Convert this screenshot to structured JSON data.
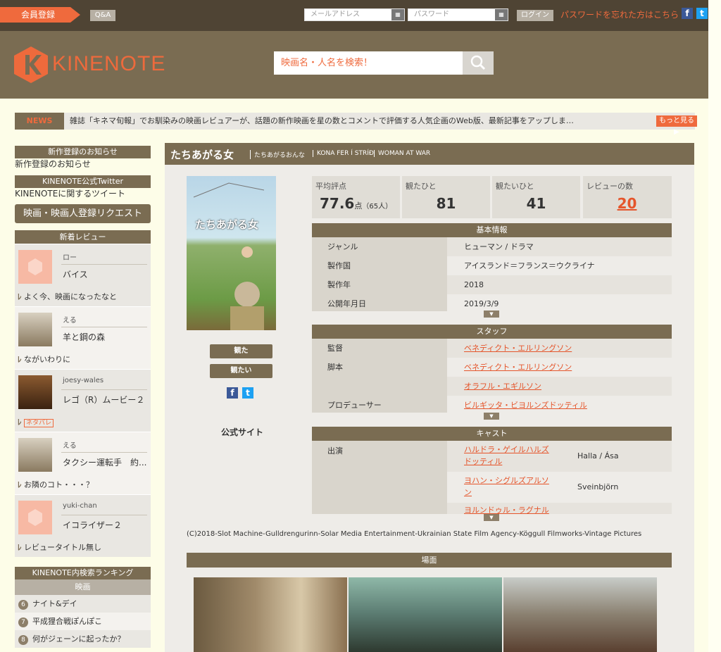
{
  "topbar": {
    "signup": "会員登録",
    "qa": "Q&A",
    "email_placeholder": "メールアドレス",
    "password_placeholder": "パスワード",
    "login": "ログイン",
    "forgot": "パスワードを忘れた方はこちら",
    "facebook": "f",
    "twitter": "t"
  },
  "header": {
    "brand": "KINENOTE",
    "search_placeholder": "映画名・人名を検索！"
  },
  "news": {
    "label": "NEWS",
    "text": "雑誌「キネマ旬報」でお馴染みの映画レビュアーが、話題の新作映画を星の数とコメントで評価する人気企画のWeb版、最新記事をアップしま…",
    "more": "もっと見る"
  },
  "sidebar": {
    "new_works_header": "新作登録のお知らせ",
    "new_works_link": "新作登録のお知らせ",
    "twitter_header": "KINENOTE公式Twitter",
    "twitter_link": "KINENOTEに関するツイート",
    "request_button": "映画・映画人登録リクエスト",
    "reviews_header": "新着レビュー",
    "reviews": [
      {
        "user": "ロー",
        "movie": "バイス",
        "title": "よく今、映画になったなと",
        "spoiler": ""
      },
      {
        "user": "える",
        "movie": "羊と鋼の森",
        "title": "ながいわりに",
        "spoiler": ""
      },
      {
        "user": "joesy-wales",
        "movie": "レゴ（R）ムービー２",
        "title": "",
        "spoiler": "ネタバレ"
      },
      {
        "user": "える",
        "movie": "タクシー運転手　約...",
        "title": "お隣のコト・・・？",
        "spoiler": ""
      },
      {
        "user": "yuki-chan",
        "movie": "イコライザー２",
        "title": "レビュータイトル無し",
        "spoiler": ""
      }
    ],
    "ranking_header": "KINENOTE内検索ランキング",
    "ranking_tab": "映画",
    "ranking": [
      {
        "num": "6",
        "title": "ナイト&デイ"
      },
      {
        "num": "7",
        "title": "平成狸合戦ぽんぽこ"
      },
      {
        "num": "8",
        "title": "何がジェーンに起ったか？"
      }
    ]
  },
  "movie": {
    "title": "たちあがる女",
    "alt_titles": [
      "たちあがるおんな",
      "KONA FER Í STRÍÐ",
      "WOMAN AT WAR"
    ],
    "poster_title": "たちあがる女",
    "watched_button": "観た",
    "want_button": "観たい",
    "facebook": "f",
    "twitter": "t",
    "official_site": "公式サイト",
    "stats": {
      "avg_label": "平均評点",
      "avg_value": "77.6",
      "avg_unit": "点",
      "avg_count": "（65人）",
      "watched_label": "観たひと",
      "watched_value": "81",
      "want_label": "観たいひと",
      "want_value": "41",
      "reviews_label": "レビューの数",
      "reviews_value": "20"
    },
    "basic_header": "基本情報",
    "basic": [
      {
        "k": "ジャンル",
        "v": "ヒューマン / ドラマ"
      },
      {
        "k": "製作国",
        "v": "アイスランド＝フランス＝ウクライナ"
      },
      {
        "k": "製作年",
        "v": "2018"
      },
      {
        "k": "公開年月日",
        "v": "2019/3/9"
      }
    ],
    "staff_header": "スタッフ",
    "staff": [
      {
        "k": "監督",
        "v": "ベネディクト・エルリングソン"
      },
      {
        "k": "脚本",
        "v": "ベネディクト・エルリングソン"
      },
      {
        "k": "",
        "v": "オラフル・エギルソン"
      },
      {
        "k": "プロデューサー",
        "v": "ビルギッタ・ビヨルンズドッティル"
      }
    ],
    "cast_header": "キャスト",
    "cast": [
      {
        "k": "出演",
        "v": "ハルドラ・ゲイルハルズドッティル",
        "role": "Halla / Ása"
      },
      {
        "k": "",
        "v": "ヨハン・シグルズアルソン",
        "role": "Sveinbjörn"
      },
      {
        "k": "",
        "v": "ヨルンドゥル・ラグナルソ",
        "role": ""
      }
    ],
    "copyright": "(C)2018-Slot Machine-Gulldrengurinn-Solar Media Entertainment-Ukrainian State Film Agency-Köggull Filmworks-Vintage Pictures",
    "scenes_header": "場面",
    "expand_arrow": "▼"
  }
}
